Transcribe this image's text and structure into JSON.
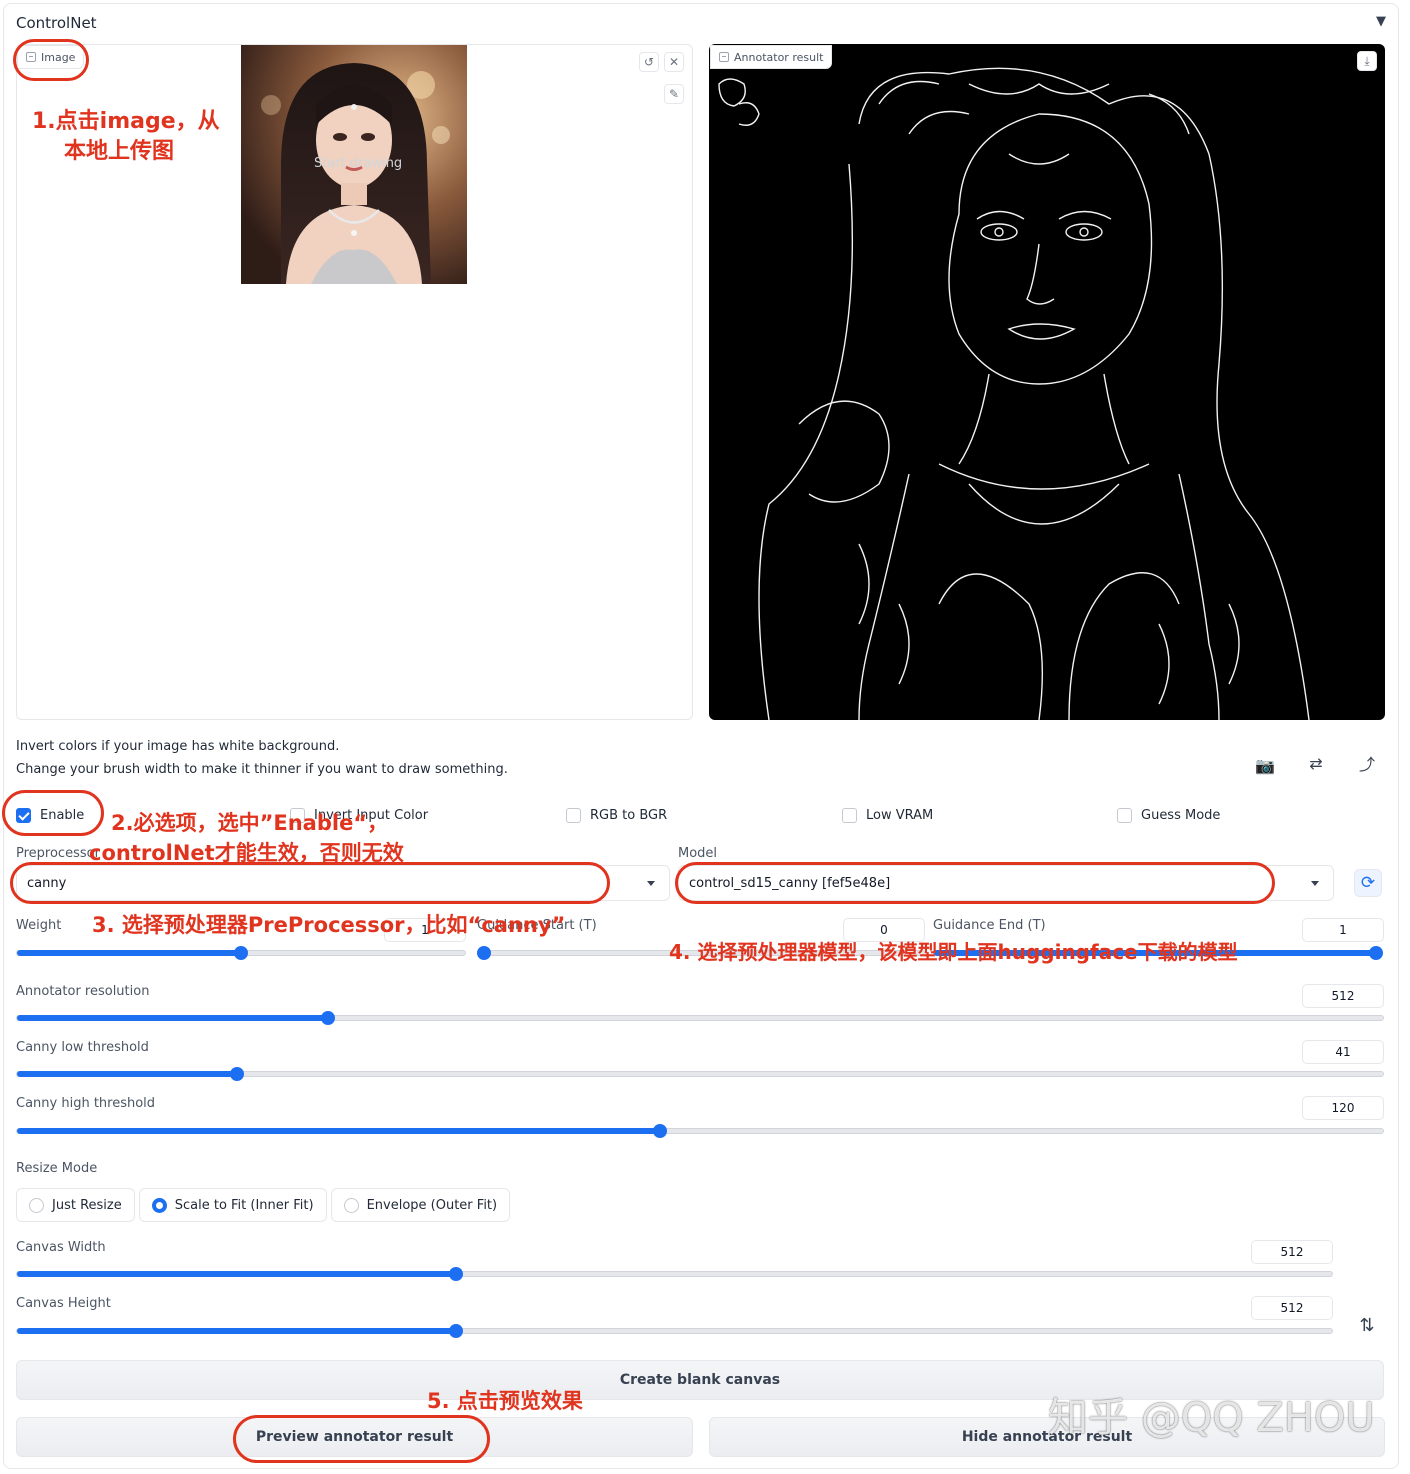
{
  "header": {
    "title": "ControlNet",
    "collapse_glyph": "▼"
  },
  "image_panel": {
    "label": "Image",
    "start_drawing": "Start drawing",
    "icons": [
      "undo-icon",
      "close-icon",
      "brush-icon"
    ]
  },
  "result_panel": {
    "label": "Annotator result",
    "icons": [
      "download-icon"
    ]
  },
  "hints": [
    "Invert colors if your image has white background.",
    "Change your brush width to make it thinner if you want to draw something."
  ],
  "tool_icons": {
    "camera": "📷",
    "swap": "⇄",
    "send_up": "⤴"
  },
  "checkboxes": [
    {
      "label": "Enable",
      "checked": true
    },
    {
      "label": "Invert Input Color",
      "checked": false
    },
    {
      "label": "RGB to BGR",
      "checked": false
    },
    {
      "label": "Low VRAM",
      "checked": false
    },
    {
      "label": "Guess Mode",
      "checked": false
    }
  ],
  "preprocessor": {
    "label": "Preprocessor",
    "value": "canny"
  },
  "model": {
    "label": "Model",
    "value": "control_sd15_canny [fef5e48e]",
    "refresh_icon": "⟳"
  },
  "sliders": {
    "weight": {
      "label": "Weight",
      "value": "1",
      "fraction": 0.5
    },
    "guidance_start": {
      "label": "Guidance Start (T)",
      "value": "0",
      "fraction": 0.0
    },
    "guidance_end": {
      "label": "Guidance End (T)",
      "value": "1",
      "fraction": 1.0
    },
    "annotator_resolution": {
      "label": "Annotator resolution",
      "value": "512",
      "fraction": 0.228
    },
    "canny_low": {
      "label": "Canny low threshold",
      "value": "41",
      "fraction": 0.161
    },
    "canny_high": {
      "label": "Canny high threshold",
      "value": "120",
      "fraction": 0.471
    },
    "canvas_width": {
      "label": "Canvas Width",
      "value": "512",
      "fraction": 0.334
    },
    "canvas_height": {
      "label": "Canvas Height",
      "value": "512",
      "fraction": 0.334
    }
  },
  "resize_mode": {
    "label": "Resize Mode",
    "options": [
      "Just Resize",
      "Scale to Fit (Inner Fit)",
      "Envelope (Outer Fit)"
    ],
    "selected": 1
  },
  "swap_dims_icon": "⇅",
  "buttons": {
    "create_canvas": "Create blank canvas",
    "preview": "Preview annotator result",
    "hide": "Hide annotator result"
  },
  "annotations": {
    "a1_line1": "1.点击image，从",
    "a1_line2": "本地上传图",
    "a2_line1": "2.必选项，选中”Enable“，",
    "a2_line2": "controlNet才能生效，否则无效",
    "a3": "3. 选择预处理器PreProcessor，比如“canny”",
    "a4": "4. 选择预处理器模型，该模型即上面huggingface下载的模型",
    "a5": "5. 点击预览效果"
  },
  "watermark": "知乎 @QQ ZHOU",
  "colors": {
    "accent": "#1d6ff2",
    "annotation": "#e0341f"
  }
}
